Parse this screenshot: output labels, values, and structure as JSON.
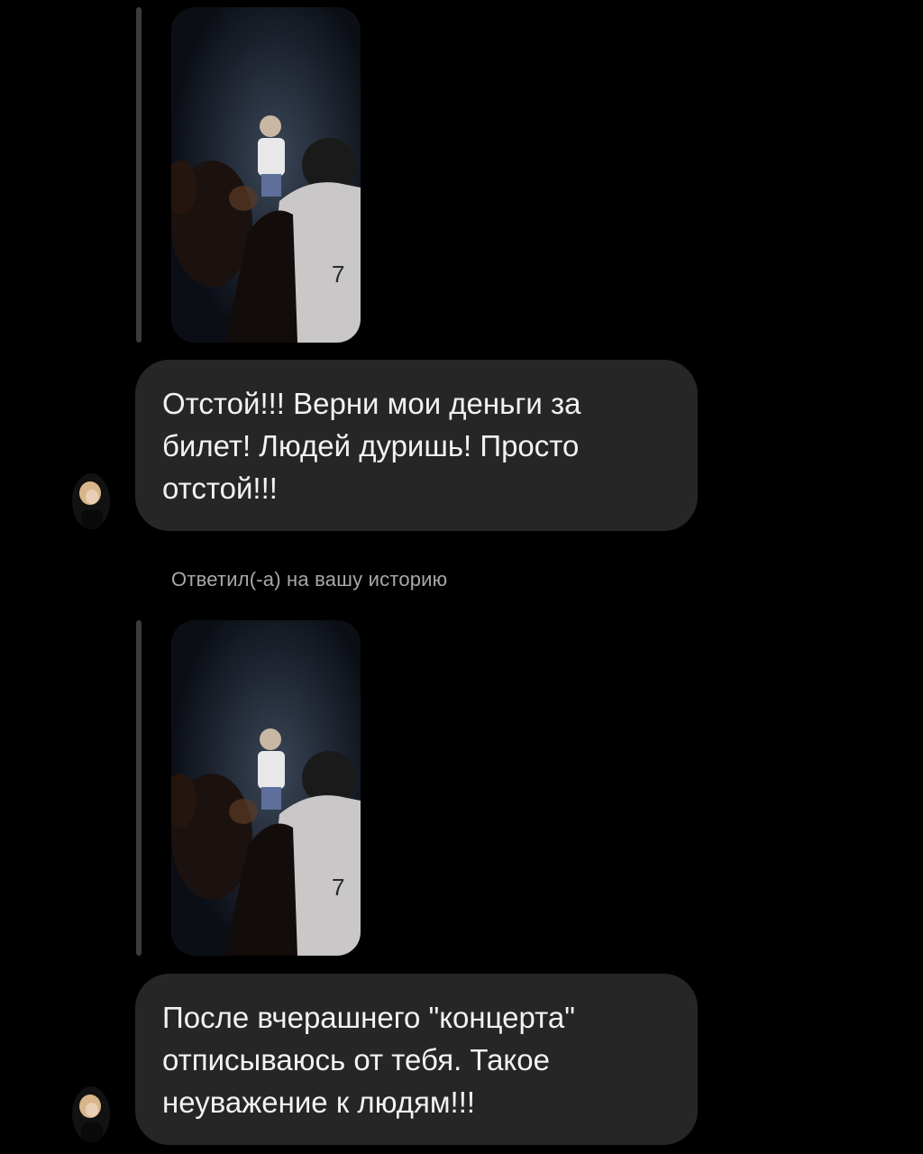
{
  "messages": [
    {
      "type": "story-reply",
      "story_thumbnail": "concert-stage-photo",
      "text": "Отстой!!! Верни мои деньги за билет! Людей дуришь! Просто отстой!!!"
    },
    {
      "type": "story-reply",
      "label": "Ответил(-а) на вашу историю",
      "story_thumbnail": "concert-stage-photo",
      "text": "После вчерашнего \"концерта\" отписываюсь от тебя. Такое неуважение к людям!!!"
    }
  ],
  "colors": {
    "background": "#000000",
    "bubble": "#262626",
    "reply_line": "#3c3c3c",
    "label_text": "#a8a8a8"
  }
}
